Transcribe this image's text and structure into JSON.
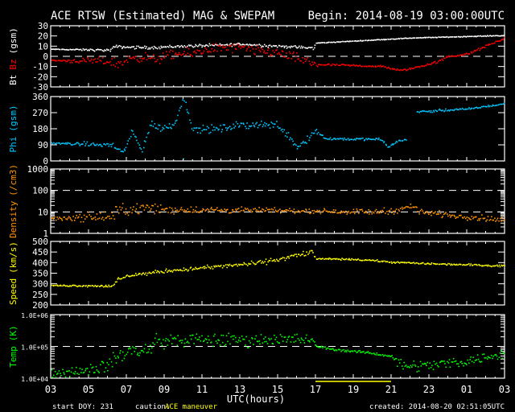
{
  "title": "ACE RTSW (Estimated) MAG & SWEPAM",
  "begin": "Begin: 2014-08-19 03:00:00UTC",
  "footer": {
    "start_doy": "start DOY: 231",
    "caution_label": "caution:",
    "caution_text": "ACE maneuver",
    "created": "created: 2014-08-20 02:51:05UTC"
  },
  "colors": {
    "bt": "#ffffff",
    "bz": "#ff0000",
    "phi": "#00c8ff",
    "density": "#ff9400",
    "speed": "#ffff00",
    "temp": "#00ff00",
    "caution": "#ffff00"
  },
  "chart_data": {
    "type": "scatter",
    "xlabel": "UTC(hours)",
    "x_range_hours": [
      0,
      24
    ],
    "x_tick_labels": [
      "03",
      "05",
      "07",
      "09",
      "11",
      "13",
      "15",
      "17",
      "19",
      "21",
      "23",
      "01",
      "03"
    ],
    "caution_interval_hours": [
      14,
      18
    ],
    "panels": [
      {
        "id": "mag",
        "ylabel_parts": [
          {
            "text": "Bt",
            "color": "#ffffff"
          },
          {
            "text": "Bz",
            "color": "#ff0000"
          },
          {
            "text": "(gsm)",
            "color": "#ffffff"
          }
        ],
        "scale": "linear",
        "ylim": [
          -30,
          30
        ],
        "y_ticks": [
          -30,
          -20,
          -10,
          0,
          10,
          20,
          30
        ],
        "y_tick_labels": [
          "-30",
          "-20",
          "-10",
          "0",
          "10",
          "20",
          "30"
        ],
        "dashed": [
          0
        ],
        "series": [
          {
            "name": "Bt",
            "color": "#ffffff",
            "noise": [
              [
                0,
                0.2
              ],
              [
                3.3,
                1.2
              ],
              [
                13.9,
                1.2
              ],
              [
                14,
                0.3
              ],
              [
                24,
                0.3
              ]
            ],
            "trend": [
              [
                0,
                7
              ],
              [
                3.2,
                6
              ],
              [
                3.3,
                9.5
              ],
              [
                5,
                8.5
              ],
              [
                7,
                10
              ],
              [
                9,
                11
              ],
              [
                10,
                12
              ],
              [
                12,
                10
              ],
              [
                13,
                9
              ],
              [
                13.9,
                8
              ],
              [
                14,
                13
              ],
              [
                17,
                16
              ],
              [
                19,
                18
              ],
              [
                21,
                19
              ],
              [
                23,
                20
              ],
              [
                24,
                20.5
              ]
            ]
          },
          {
            "name": "Bz",
            "color": "#ff0000",
            "noise": [
              [
                0,
                0.3
              ],
              [
                3.3,
                4
              ],
              [
                14,
                4
              ],
              [
                14.2,
                0.8
              ],
              [
                24,
                1
              ]
            ],
            "trend": [
              [
                0,
                -4
              ],
              [
                3.2,
                -5
              ],
              [
                3.5,
                -8
              ],
              [
                4.5,
                0
              ],
              [
                5.5,
                -3
              ],
              [
                6.5,
                2
              ],
              [
                7.5,
                3
              ],
              [
                8.5,
                8
              ],
              [
                10,
                8
              ],
              [
                11,
                5
              ],
              [
                12,
                4
              ],
              [
                12.5,
                0
              ],
              [
                13,
                -2
              ],
              [
                14,
                -8
              ],
              [
                16,
                -9
              ],
              [
                17.5,
                -10
              ],
              [
                18.5,
                -14
              ],
              [
                19.5,
                -10
              ],
              [
                20.5,
                -5
              ],
              [
                21,
                0
              ],
              [
                22,
                2
              ],
              [
                23,
                10
              ],
              [
                23.5,
                14
              ],
              [
                24,
                18
              ]
            ]
          }
        ]
      },
      {
        "id": "phi",
        "ylabel_parts": [
          {
            "text": "Phi",
            "color": "#00c8ff"
          },
          {
            "text": "(gsm)",
            "color": "#00c8ff"
          }
        ],
        "scale": "linear",
        "ylim": [
          0,
          360
        ],
        "y_ticks": [
          0,
          90,
          180,
          270,
          360
        ],
        "y_tick_labels": [
          "0",
          "90",
          "180",
          "270",
          "360"
        ],
        "dashed": [],
        "series": [
          {
            "name": "Phi",
            "color": "#00c8ff",
            "noise": [
              [
                0,
                3
              ],
              [
                3.3,
                15
              ],
              [
                14,
                20
              ],
              [
                14.5,
                6
              ],
              [
                24,
                5
              ]
            ],
            "gap": [
              18.8,
              19.3
            ],
            "trend": [
              [
                0,
                100
              ],
              [
                3.3,
                88
              ],
              [
                3.8,
                45
              ],
              [
                4.3,
                160
              ],
              [
                4.8,
                60
              ],
              [
                5.3,
                210
              ],
              [
                5.8,
                180
              ],
              [
                6.5,
                200
              ],
              [
                7,
                360
              ],
              [
                7.5,
                175
              ],
              [
                9,
                180
              ],
              [
                10,
                200
              ],
              [
                11,
                205
              ],
              [
                12,
                200
              ],
              [
                12.5,
                150
              ],
              [
                13,
                80
              ],
              [
                13.5,
                120
              ],
              [
                14,
                170
              ],
              [
                14.5,
                125
              ],
              [
                17.5,
                120
              ],
              [
                17.8,
                75
              ],
              [
                18.3,
                110
              ],
              [
                18.8,
                120
              ],
              [
                19.3,
                275
              ],
              [
                22,
                290
              ],
              [
                24,
                320
              ]
            ]
          }
        ]
      },
      {
        "id": "density",
        "ylabel_parts": [
          {
            "text": "Density",
            "color": "#ff9400"
          },
          {
            "text": "(/cm3)",
            "color": "#ff9400"
          }
        ],
        "scale": "log",
        "ylim": [
          1,
          1000
        ],
        "y_ticks": [
          1,
          10,
          100,
          1000
        ],
        "y_tick_labels": [
          "1",
          "10",
          "100",
          "1000"
        ],
        "dashed": [
          10,
          100
        ],
        "series": [
          {
            "name": "Density",
            "color": "#ff9400",
            "noise_log": [
              [
                0,
                0.05
              ],
              [
                3.3,
                0.25
              ],
              [
                8,
                0.12
              ],
              [
                14,
                0.08
              ],
              [
                18,
                0.12
              ],
              [
                24,
                0.1
              ]
            ],
            "trend": [
              [
                0,
                5
              ],
              [
                3.3,
                6
              ],
              [
                3.5,
                12
              ],
              [
                5,
                15
              ],
              [
                6,
                13
              ],
              [
                10,
                12
              ],
              [
                14,
                11
              ],
              [
                17,
                10
              ],
              [
                18.3,
                12
              ],
              [
                19,
                18
              ],
              [
                19.6,
                10
              ],
              [
                21,
                7
              ],
              [
                23,
                5
              ],
              [
                24,
                4
              ]
            ]
          }
        ]
      },
      {
        "id": "speed",
        "ylabel_parts": [
          {
            "text": "Speed",
            "color": "#ffff00"
          },
          {
            "text": "(km/s)",
            "color": "#ffff00"
          }
        ],
        "scale": "linear",
        "ylim": [
          200,
          500
        ],
        "y_ticks": [
          200,
          250,
          300,
          350,
          400,
          450,
          500
        ],
        "y_tick_labels": [
          "200",
          "250",
          "300",
          "350",
          "400",
          "450",
          "500"
        ],
        "dashed": [],
        "series": [
          {
            "name": "Speed",
            "color": "#ffff00",
            "noise": [
              [
                0,
                2
              ],
              [
                3.3,
                6
              ],
              [
                13.9,
                10
              ],
              [
                14,
                3
              ],
              [
                24,
                4
              ]
            ],
            "trend": [
              [
                0,
                292
              ],
              [
                3.3,
                290
              ],
              [
                3.5,
                318
              ],
              [
                4.2,
                340
              ],
              [
                6,
                360
              ],
              [
                8,
                375
              ],
              [
                10,
                390
              ],
              [
                11,
                400
              ],
              [
                12,
                415
              ],
              [
                13,
                435
              ],
              [
                13.8,
                450
              ],
              [
                14,
                418
              ],
              [
                16,
                415
              ],
              [
                17,
                410
              ],
              [
                18,
                402
              ],
              [
                20,
                395
              ],
              [
                22,
                390
              ],
              [
                24,
                385
              ]
            ]
          }
        ]
      },
      {
        "id": "temp",
        "ylabel_parts": [
          {
            "text": "Temp",
            "color": "#00ff00"
          },
          {
            "text": "(K)",
            "color": "#00ff00"
          }
        ],
        "scale": "log",
        "ylim": [
          10000,
          1000000
        ],
        "y_ticks": [
          10000,
          100000,
          1000000
        ],
        "y_tick_labels": [
          "1.0E+04",
          "1.0E+05",
          "1.0E+06"
        ],
        "dashed": [
          100000
        ],
        "series": [
          {
            "name": "Temp",
            "color": "#00ff00",
            "noise_log": [
              [
                0,
                0.1
              ],
              [
                3.5,
                0.2
              ],
              [
                13.5,
                0.15
              ],
              [
                14,
                0.03
              ],
              [
                18,
                0.03
              ],
              [
                18.3,
                0.15
              ],
              [
                24,
                0.12
              ]
            ],
            "trend": [
              [
                0,
                13000
              ],
              [
                1,
                16000
              ],
              [
                2,
                20000
              ],
              [
                3,
                25000
              ],
              [
                3.6,
                50000
              ],
              [
                4,
                70000
              ],
              [
                5,
                70000
              ],
              [
                5.8,
                150000
              ],
              [
                8,
                160000
              ],
              [
                10,
                160000
              ],
              [
                13,
                170000
              ],
              [
                13.8,
                160000
              ],
              [
                14,
                100000
              ],
              [
                15,
                80000
              ],
              [
                16,
                70000
              ],
              [
                17,
                60000
              ],
              [
                18,
                50000
              ],
              [
                18.3,
                30000
              ],
              [
                19,
                25000
              ],
              [
                20,
                25000
              ],
              [
                22,
                35000
              ],
              [
                23,
                45000
              ],
              [
                24,
                60000
              ]
            ]
          }
        ]
      }
    ]
  }
}
